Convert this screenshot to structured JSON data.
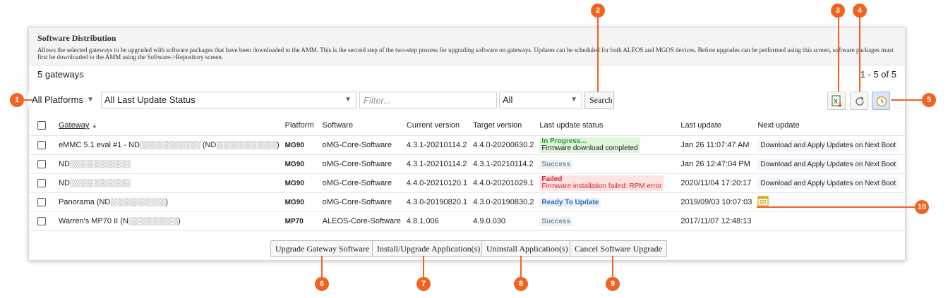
{
  "header": {
    "title": "Software Distribution",
    "description": "Allows the selected gateways to be upgraded with software packages that have been downloaded to the AMM. This is the second step of the two-step process for upgrading software on gateways. Updates can be scheduled for both ALEOS and MGOS devices. Before upgrades can be performed using this screen, software packages must first be downloaded to the AMM using the Software->Repository screen."
  },
  "summary": {
    "count": "5 gateways",
    "pager": "1 - 5 of 5"
  },
  "filters": {
    "platform": "All Platforms",
    "status": "All Last Update Status",
    "filter_placeholder": "Filter...",
    "scope": "All",
    "search_label": "Search"
  },
  "columns": {
    "gateway": "Gateway",
    "platform": "Platform",
    "software": "Software",
    "current_version": "Current version",
    "target_version": "Target version",
    "last_update_status": "Last update status",
    "last_update": "Last update",
    "next_update": "Next update"
  },
  "rows": [
    {
      "gateway": "eMMC 5.1 eval #1 - ND░░░░░░░░░░░ (ND░░░░░░░░░░░)",
      "platform": "MG90",
      "software": "oMG-Core-Software",
      "current": "4.3.1-20210114.2",
      "target": "4.4.0-20200630.2",
      "status_title": "In Progress...",
      "status_detail": "Firmware download completed",
      "last_update": "Jan 26 11:07:47 AM",
      "next_update": "Download and Apply Updates on Next Boot"
    },
    {
      "gateway": "ND░░░░░░░░░░░",
      "platform": "MG90",
      "software": "oMG-Core-Software",
      "current": "4.3.1-20210114.2",
      "target": "4.3.1-20210114.2",
      "status_title": "Success",
      "last_update": "Jan 26 12:47:04 PM",
      "next_update": "Download and Apply Updates on Next Boot"
    },
    {
      "gateway": "ND░░░░░░░░░░░",
      "platform": "MG90",
      "software": "oMG-Core-Software",
      "current": "4.4.0-20210120.1",
      "target": "4.4.0-20201029.1",
      "status_title": "Failed",
      "status_detail": "Firmware installation failed: RPM error",
      "last_update": "2020/11/04 17:20:17",
      "next_update": "Download and Apply Updates on Next Boot"
    },
    {
      "gateway": "Panorama (ND░░░░░░░░░░)",
      "platform": "MG90",
      "software": "oMG-Core-Software",
      "current": "4.3.0-20190820.1",
      "target": "4.3.0-20190830.2",
      "status_title": "Ready To Update",
      "last_update": "2019/09/03 10:07:03",
      "next_update": ""
    },
    {
      "gateway": "Warren's MP70 II (N░░░░░░░░░)",
      "platform": "MP70",
      "software": "ALEOS-Core-Software",
      "current": "4.8.1.006",
      "target": "4.9.0.030",
      "status_title": "Success",
      "last_update": "2017/11/07 12:48:13",
      "next_update": ""
    }
  ],
  "actions": {
    "upgrade": "Upgrade Gateway Software",
    "install": "Install/Upgrade Application(s)",
    "uninstall": "Uninstall Application(s)",
    "cancel": "Cancel Software Upgrade"
  },
  "toolbar_icons": [
    "excel-export-icon",
    "refresh-icon",
    "schedule-clock-icon"
  ],
  "callouts": [
    "1",
    "2",
    "3",
    "4",
    "5",
    "6",
    "7",
    "8",
    "9",
    "10"
  ],
  "colors": {
    "callout": "#f26322",
    "success_text": "#7a8ea6",
    "ready_text": "#2d6cc2",
    "progress_text": "#2c9a2c",
    "failed_text": "#d9232a"
  }
}
